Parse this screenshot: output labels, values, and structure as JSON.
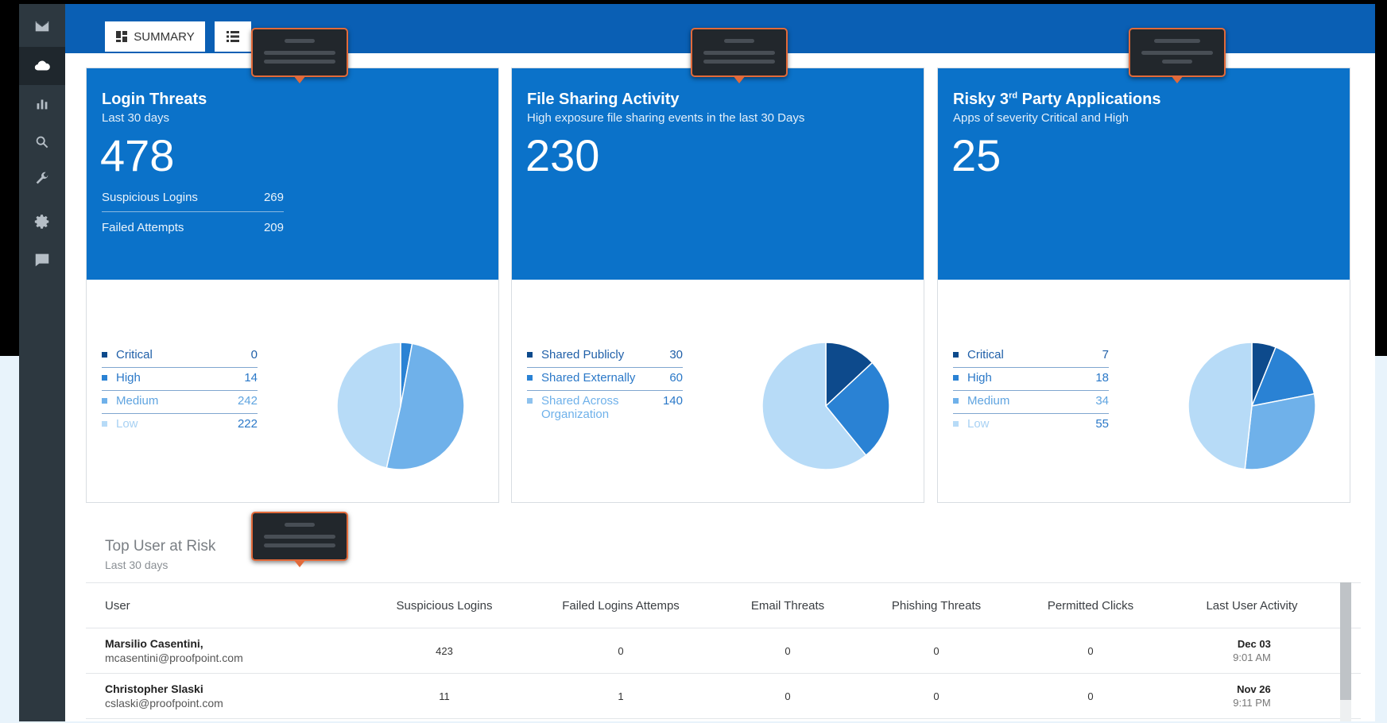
{
  "tabs": {
    "summary_label": "SUMMARY",
    "summary_icon": "dashboard-icon",
    "list_icon": "list-icon"
  },
  "sidebar": {
    "items": [
      "mail-icon",
      "cloud-icon",
      "bar-chart-icon",
      "search-icon",
      "wrench-icon",
      "gear-icon",
      "chat-icon"
    ],
    "active": "cloud-icon"
  },
  "colors": {
    "header_blue": "#0a5fb4",
    "card_blue": "#0b72c9",
    "critical": "#0d4a8c",
    "high": "#2a82d4",
    "medium": "#6fb1ea",
    "low": "#b7dbf7",
    "tooltip_border": "#e26a3a"
  },
  "cards": [
    {
      "title": "Login Threats",
      "subtitle": "Last 30 days",
      "value": "478",
      "stats": [
        {
          "label": "Suspicious Logins",
          "value": "269"
        },
        {
          "label": "Failed Attempts",
          "value": "209"
        }
      ],
      "legend": [
        {
          "label": "Critical",
          "value": "0"
        },
        {
          "label": "High",
          "value": "14"
        },
        {
          "label": "Medium",
          "value": "242"
        },
        {
          "label": "Low",
          "value": "222"
        }
      ]
    },
    {
      "title": "File Sharing Activity",
      "subtitle": "High exposure file sharing events in the last 30 Days",
      "value": "230",
      "legend": [
        {
          "label": "Shared Publicly",
          "value": "30"
        },
        {
          "label": "Shared Externally",
          "value": "60"
        },
        {
          "label": "Shared Across Organization",
          "value": "140"
        }
      ]
    },
    {
      "title": "Risky 3",
      "title_sup": "rd",
      "title_rest": " Party Applications",
      "subtitle": "Apps of severity Critical and High",
      "value": "25",
      "legend": [
        {
          "label": "Critical",
          "value": "7"
        },
        {
          "label": "High",
          "value": "18"
        },
        {
          "label": "Medium",
          "value": "34"
        },
        {
          "label": "Low",
          "value": "55"
        }
      ]
    }
  ],
  "risk": {
    "title": "Top User at Risk",
    "subtitle": "Last 30 days",
    "columns": [
      "User",
      "Suspicious Logins",
      "Failed Logins Attemps",
      "Email Threats",
      "Phishing Threats",
      "Permitted Clicks",
      "Last User Activity"
    ],
    "rows": [
      {
        "name": "Marsilio Casentini,",
        "email": "mcasentini@proofpoint.com",
        "suspicious": "423",
        "failed": "0",
        "email_threats": "0",
        "phishing": "0",
        "clicks": "0",
        "date": "Dec 03",
        "time": "9:01 AM"
      },
      {
        "name": "Christopher Slaski",
        "email": "cslaski@proofpoint.com",
        "suspicious": "11",
        "failed": "1",
        "email_threats": "0",
        "phishing": "0",
        "clicks": "0",
        "date": "Nov 26",
        "time": "9:11 PM"
      }
    ]
  },
  "chart_data": [
    {
      "type": "pie",
      "categories": [
        "Critical",
        "High",
        "Medium",
        "Low"
      ],
      "values": [
        0,
        14,
        242,
        222
      ]
    },
    {
      "type": "pie",
      "categories": [
        "Shared Publicly",
        "Shared Externally",
        "Shared Across Organization"
      ],
      "values": [
        30,
        60,
        140
      ]
    },
    {
      "type": "pie",
      "categories": [
        "Critical",
        "High",
        "Medium",
        "Low"
      ],
      "values": [
        7,
        18,
        34,
        55
      ]
    }
  ]
}
